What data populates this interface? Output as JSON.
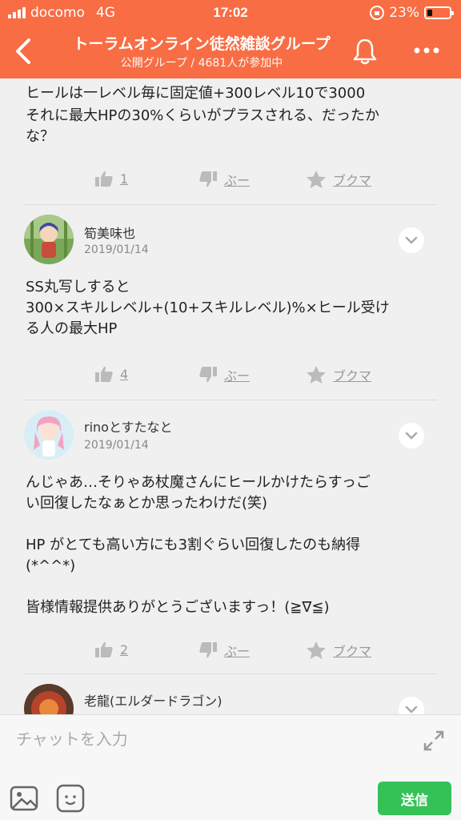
{
  "status_bar": {
    "carrier": "docomo",
    "network": "4G",
    "time": "17:02",
    "battery": "23%",
    "battery_level": 0.23
  },
  "header": {
    "title": "トーラムオンライン徒然雑談グループ",
    "subtitle": "公開グループ / 4681人が参加中",
    "icons": [
      "back-icon",
      "bell-icon",
      "more-icon"
    ]
  },
  "posts": [
    {
      "body": [
        "ヒールは一レベル毎に固定値+300レベル10で3000",
        "それに最大HPの30%くらいがプラスされる、だったか",
        "な？"
      ],
      "like_count": "1",
      "dislike_label": "ぶー",
      "bookmark_label": "ブクマ"
    },
    {
      "author": "筍美味也",
      "date": "2019/01/14",
      "body": [
        "SS丸写しすると",
        "300×スキルレベル+(10+スキルレベル)%×ヒール受け",
        "る人の最大HP"
      ],
      "like_count": "4",
      "dislike_label": "ぶー",
      "bookmark_label": "ブクマ"
    },
    {
      "author": "rinoとすたなと",
      "date": "2019/01/14",
      "body": [
        "んじゃあ…そりゃあ杖魔さんにヒールかけたらすっご",
        "い回復したなぁとか思ったわけだ(笑)",
        "",
        "HP がとても高い方にも3割ぐらい回復したのも納得",
        "(*^^*)",
        "",
        "皆様情報提供ありがとうございますっ！(≧∇≦)"
      ],
      "like_count": "2",
      "dislike_label": "ぶー",
      "bookmark_label": "ブクマ"
    },
    {
      "author": "老龍(エルダードラゴン)"
    }
  ],
  "composer": {
    "placeholder": "チャットを入力",
    "send_label": "送信",
    "icons": [
      "expand-icon",
      "image-icon",
      "sticker-icon"
    ]
  },
  "colors": {
    "accent": "#f86d44",
    "send": "#34c257",
    "background": "#f0f0f0"
  }
}
